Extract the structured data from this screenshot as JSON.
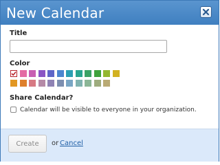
{
  "dialog": {
    "title": "New Calendar",
    "close_icon": "close-icon"
  },
  "title_section": {
    "label": "Title",
    "value": "",
    "placeholder": ""
  },
  "color_section": {
    "label": "Color",
    "selected_index": 0,
    "swatches": [
      "#d64a4f",
      "#e46ba3",
      "#c85fb3",
      "#8a55c4",
      "#5f66c8",
      "#4c86cf",
      "#2c9fb3",
      "#2aa58f",
      "#3aa265",
      "#3ea23b",
      "#93b72e",
      "#d2b222",
      "#e29723",
      "#de7f2c",
      "#d77a84",
      "#b58aa7",
      "#8f83b4",
      "#7d8fb0",
      "#79a6c4",
      "#80b3b0",
      "#8bb696",
      "#9eac7e",
      "#b9aa74"
    ]
  },
  "share_section": {
    "label": "Share Calendar?",
    "checkbox_label": "Calendar will be visible to everyone in your organization.",
    "checked": false
  },
  "footer": {
    "create_label": "Create",
    "or_text": "or",
    "cancel_label": "Cancel"
  }
}
